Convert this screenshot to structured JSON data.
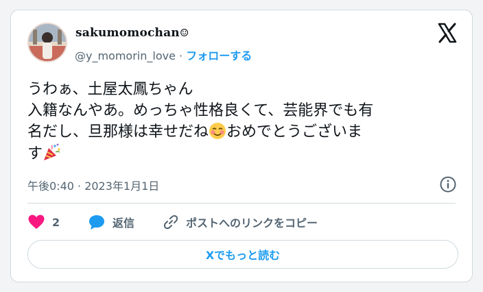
{
  "user": {
    "display_name": "sakumomochan",
    "display_name_symbol": "☺",
    "handle": "@y_momorin_love",
    "separator": " · ",
    "follow_label": "フォローする"
  },
  "tweet": {
    "line1": "うわぁ、土屋太鳳ちゃん",
    "line2": "入籍なんやあ。めっちゃ性格良くて、芸能界でも有",
    "line3a": "名だし、旦那様は幸せだね",
    "line3b": "おめでとうございま",
    "line4": "す",
    "emoji_1": "smiling-face-with-blush-icon",
    "emoji_2": "party-popper-icon"
  },
  "meta": {
    "timestamp": "午後0:40 · 2023年1月1日"
  },
  "actions": {
    "like_count": "2",
    "reply_label": "返信",
    "copy_link_label": "ポストへのリンクをコピー"
  },
  "read_more_label": "Xでもっと読む",
  "colors": {
    "accent": "#1d9bf0",
    "like": "#f91880",
    "text": "#0f1419",
    "muted": "#536471",
    "border": "#cfd9de"
  }
}
